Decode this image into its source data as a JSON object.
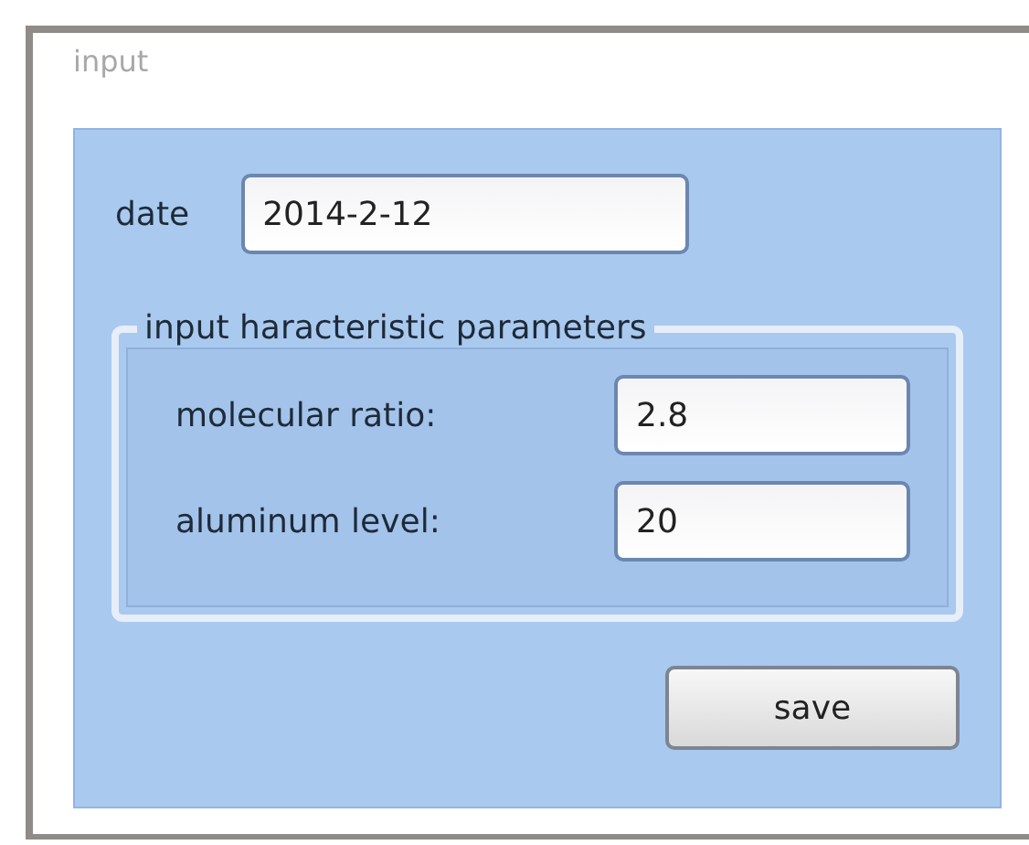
{
  "window": {
    "title": "input"
  },
  "date": {
    "label": "date",
    "value": "2014-2-12"
  },
  "group": {
    "legend": "input haracteristic parameters",
    "fields": [
      {
        "label": "molecular ratio:",
        "value": "2.8"
      },
      {
        "label": "aluminum level:",
        "value": "20"
      }
    ]
  },
  "buttons": [
    "save"
  ]
}
